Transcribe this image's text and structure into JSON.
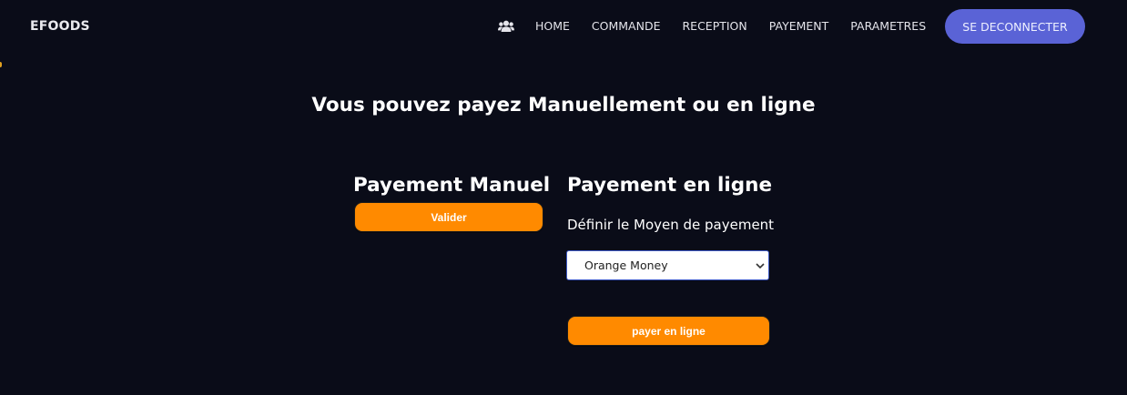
{
  "navbar": {
    "brand": "EFOODS",
    "icon": "users-icon",
    "links": [
      "HOME",
      "COMMANDE",
      "RECEPTION",
      "PAYEMENT",
      "PARAMETRES"
    ],
    "logout_label": "SE DECONNECTER"
  },
  "main": {
    "heading": "Vous pouvez payez Manuellement ou en ligne",
    "manual": {
      "title": "Payement Manuel",
      "button_label": "Valider"
    },
    "online": {
      "title": "Payement en ligne",
      "method_label": "Définir le Moyen de payement",
      "selected_method": "Orange Money",
      "button_label": "payer en ligne"
    }
  },
  "colors": {
    "background": "#0a0c18",
    "accent_orange": "#ff8a00",
    "logout_button": "#5a63d6"
  }
}
